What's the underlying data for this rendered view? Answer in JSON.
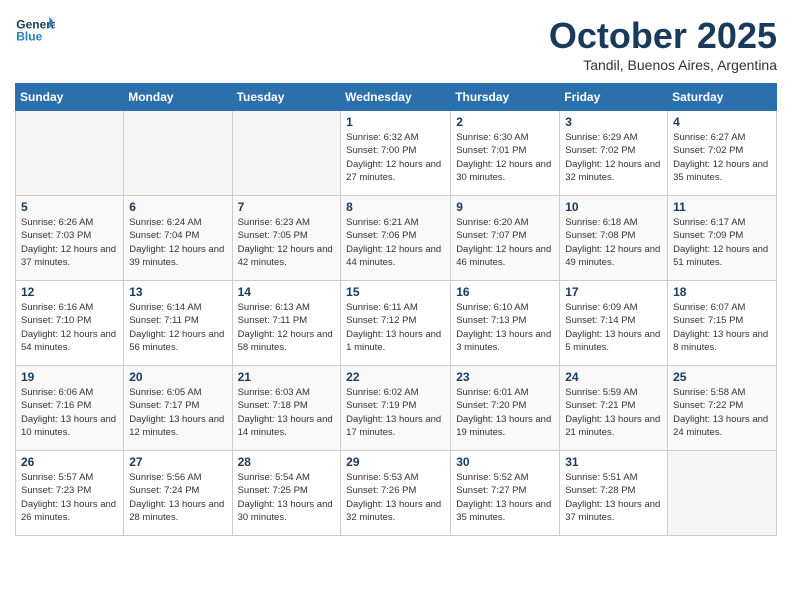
{
  "header": {
    "logo_general": "General",
    "logo_blue": "Blue",
    "month": "October 2025",
    "location": "Tandil, Buenos Aires, Argentina"
  },
  "days_of_week": [
    "Sunday",
    "Monday",
    "Tuesday",
    "Wednesday",
    "Thursday",
    "Friday",
    "Saturday"
  ],
  "weeks": [
    [
      {
        "day": "",
        "sunrise": "",
        "sunset": "",
        "daylight": ""
      },
      {
        "day": "",
        "sunrise": "",
        "sunset": "",
        "daylight": ""
      },
      {
        "day": "",
        "sunrise": "",
        "sunset": "",
        "daylight": ""
      },
      {
        "day": "1",
        "sunrise": "Sunrise: 6:32 AM",
        "sunset": "Sunset: 7:00 PM",
        "daylight": "Daylight: 12 hours and 27 minutes."
      },
      {
        "day": "2",
        "sunrise": "Sunrise: 6:30 AM",
        "sunset": "Sunset: 7:01 PM",
        "daylight": "Daylight: 12 hours and 30 minutes."
      },
      {
        "day": "3",
        "sunrise": "Sunrise: 6:29 AM",
        "sunset": "Sunset: 7:02 PM",
        "daylight": "Daylight: 12 hours and 32 minutes."
      },
      {
        "day": "4",
        "sunrise": "Sunrise: 6:27 AM",
        "sunset": "Sunset: 7:02 PM",
        "daylight": "Daylight: 12 hours and 35 minutes."
      }
    ],
    [
      {
        "day": "5",
        "sunrise": "Sunrise: 6:26 AM",
        "sunset": "Sunset: 7:03 PM",
        "daylight": "Daylight: 12 hours and 37 minutes."
      },
      {
        "day": "6",
        "sunrise": "Sunrise: 6:24 AM",
        "sunset": "Sunset: 7:04 PM",
        "daylight": "Daylight: 12 hours and 39 minutes."
      },
      {
        "day": "7",
        "sunrise": "Sunrise: 6:23 AM",
        "sunset": "Sunset: 7:05 PM",
        "daylight": "Daylight: 12 hours and 42 minutes."
      },
      {
        "day": "8",
        "sunrise": "Sunrise: 6:21 AM",
        "sunset": "Sunset: 7:06 PM",
        "daylight": "Daylight: 12 hours and 44 minutes."
      },
      {
        "day": "9",
        "sunrise": "Sunrise: 6:20 AM",
        "sunset": "Sunset: 7:07 PM",
        "daylight": "Daylight: 12 hours and 46 minutes."
      },
      {
        "day": "10",
        "sunrise": "Sunrise: 6:18 AM",
        "sunset": "Sunset: 7:08 PM",
        "daylight": "Daylight: 12 hours and 49 minutes."
      },
      {
        "day": "11",
        "sunrise": "Sunrise: 6:17 AM",
        "sunset": "Sunset: 7:09 PM",
        "daylight": "Daylight: 12 hours and 51 minutes."
      }
    ],
    [
      {
        "day": "12",
        "sunrise": "Sunrise: 6:16 AM",
        "sunset": "Sunset: 7:10 PM",
        "daylight": "Daylight: 12 hours and 54 minutes."
      },
      {
        "day": "13",
        "sunrise": "Sunrise: 6:14 AM",
        "sunset": "Sunset: 7:11 PM",
        "daylight": "Daylight: 12 hours and 56 minutes."
      },
      {
        "day": "14",
        "sunrise": "Sunrise: 6:13 AM",
        "sunset": "Sunset: 7:11 PM",
        "daylight": "Daylight: 12 hours and 58 minutes."
      },
      {
        "day": "15",
        "sunrise": "Sunrise: 6:11 AM",
        "sunset": "Sunset: 7:12 PM",
        "daylight": "Daylight: 13 hours and 1 minute."
      },
      {
        "day": "16",
        "sunrise": "Sunrise: 6:10 AM",
        "sunset": "Sunset: 7:13 PM",
        "daylight": "Daylight: 13 hours and 3 minutes."
      },
      {
        "day": "17",
        "sunrise": "Sunrise: 6:09 AM",
        "sunset": "Sunset: 7:14 PM",
        "daylight": "Daylight: 13 hours and 5 minutes."
      },
      {
        "day": "18",
        "sunrise": "Sunrise: 6:07 AM",
        "sunset": "Sunset: 7:15 PM",
        "daylight": "Daylight: 13 hours and 8 minutes."
      }
    ],
    [
      {
        "day": "19",
        "sunrise": "Sunrise: 6:06 AM",
        "sunset": "Sunset: 7:16 PM",
        "daylight": "Daylight: 13 hours and 10 minutes."
      },
      {
        "day": "20",
        "sunrise": "Sunrise: 6:05 AM",
        "sunset": "Sunset: 7:17 PM",
        "daylight": "Daylight: 13 hours and 12 minutes."
      },
      {
        "day": "21",
        "sunrise": "Sunrise: 6:03 AM",
        "sunset": "Sunset: 7:18 PM",
        "daylight": "Daylight: 13 hours and 14 minutes."
      },
      {
        "day": "22",
        "sunrise": "Sunrise: 6:02 AM",
        "sunset": "Sunset: 7:19 PM",
        "daylight": "Daylight: 13 hours and 17 minutes."
      },
      {
        "day": "23",
        "sunrise": "Sunrise: 6:01 AM",
        "sunset": "Sunset: 7:20 PM",
        "daylight": "Daylight: 13 hours and 19 minutes."
      },
      {
        "day": "24",
        "sunrise": "Sunrise: 5:59 AM",
        "sunset": "Sunset: 7:21 PM",
        "daylight": "Daylight: 13 hours and 21 minutes."
      },
      {
        "day": "25",
        "sunrise": "Sunrise: 5:58 AM",
        "sunset": "Sunset: 7:22 PM",
        "daylight": "Daylight: 13 hours and 24 minutes."
      }
    ],
    [
      {
        "day": "26",
        "sunrise": "Sunrise: 5:57 AM",
        "sunset": "Sunset: 7:23 PM",
        "daylight": "Daylight: 13 hours and 26 minutes."
      },
      {
        "day": "27",
        "sunrise": "Sunrise: 5:56 AM",
        "sunset": "Sunset: 7:24 PM",
        "daylight": "Daylight: 13 hours and 28 minutes."
      },
      {
        "day": "28",
        "sunrise": "Sunrise: 5:54 AM",
        "sunset": "Sunset: 7:25 PM",
        "daylight": "Daylight: 13 hours and 30 minutes."
      },
      {
        "day": "29",
        "sunrise": "Sunrise: 5:53 AM",
        "sunset": "Sunset: 7:26 PM",
        "daylight": "Daylight: 13 hours and 32 minutes."
      },
      {
        "day": "30",
        "sunrise": "Sunrise: 5:52 AM",
        "sunset": "Sunset: 7:27 PM",
        "daylight": "Daylight: 13 hours and 35 minutes."
      },
      {
        "day": "31",
        "sunrise": "Sunrise: 5:51 AM",
        "sunset": "Sunset: 7:28 PM",
        "daylight": "Daylight: 13 hours and 37 minutes."
      },
      {
        "day": "",
        "sunrise": "",
        "sunset": "",
        "daylight": ""
      }
    ]
  ]
}
